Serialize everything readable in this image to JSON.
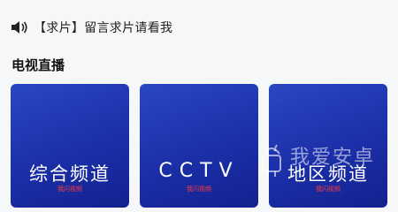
{
  "notice": {
    "icon": "speaker-icon",
    "text": "【求片】留言求片请看我"
  },
  "section": {
    "title": "电视直播"
  },
  "channels": [
    {
      "name": "综合频道",
      "tag": "我闪视频"
    },
    {
      "name": "CCTV",
      "tag": "我闪视频"
    },
    {
      "name": "地区频道",
      "tag": "我闪视频"
    }
  ],
  "watermark": {
    "icon": "android-robot-icon",
    "text": "我爱安卓"
  },
  "colors": {
    "card_top": "#2947c2",
    "card_bottom": "#14228f",
    "tag": "#ff3b3b"
  }
}
